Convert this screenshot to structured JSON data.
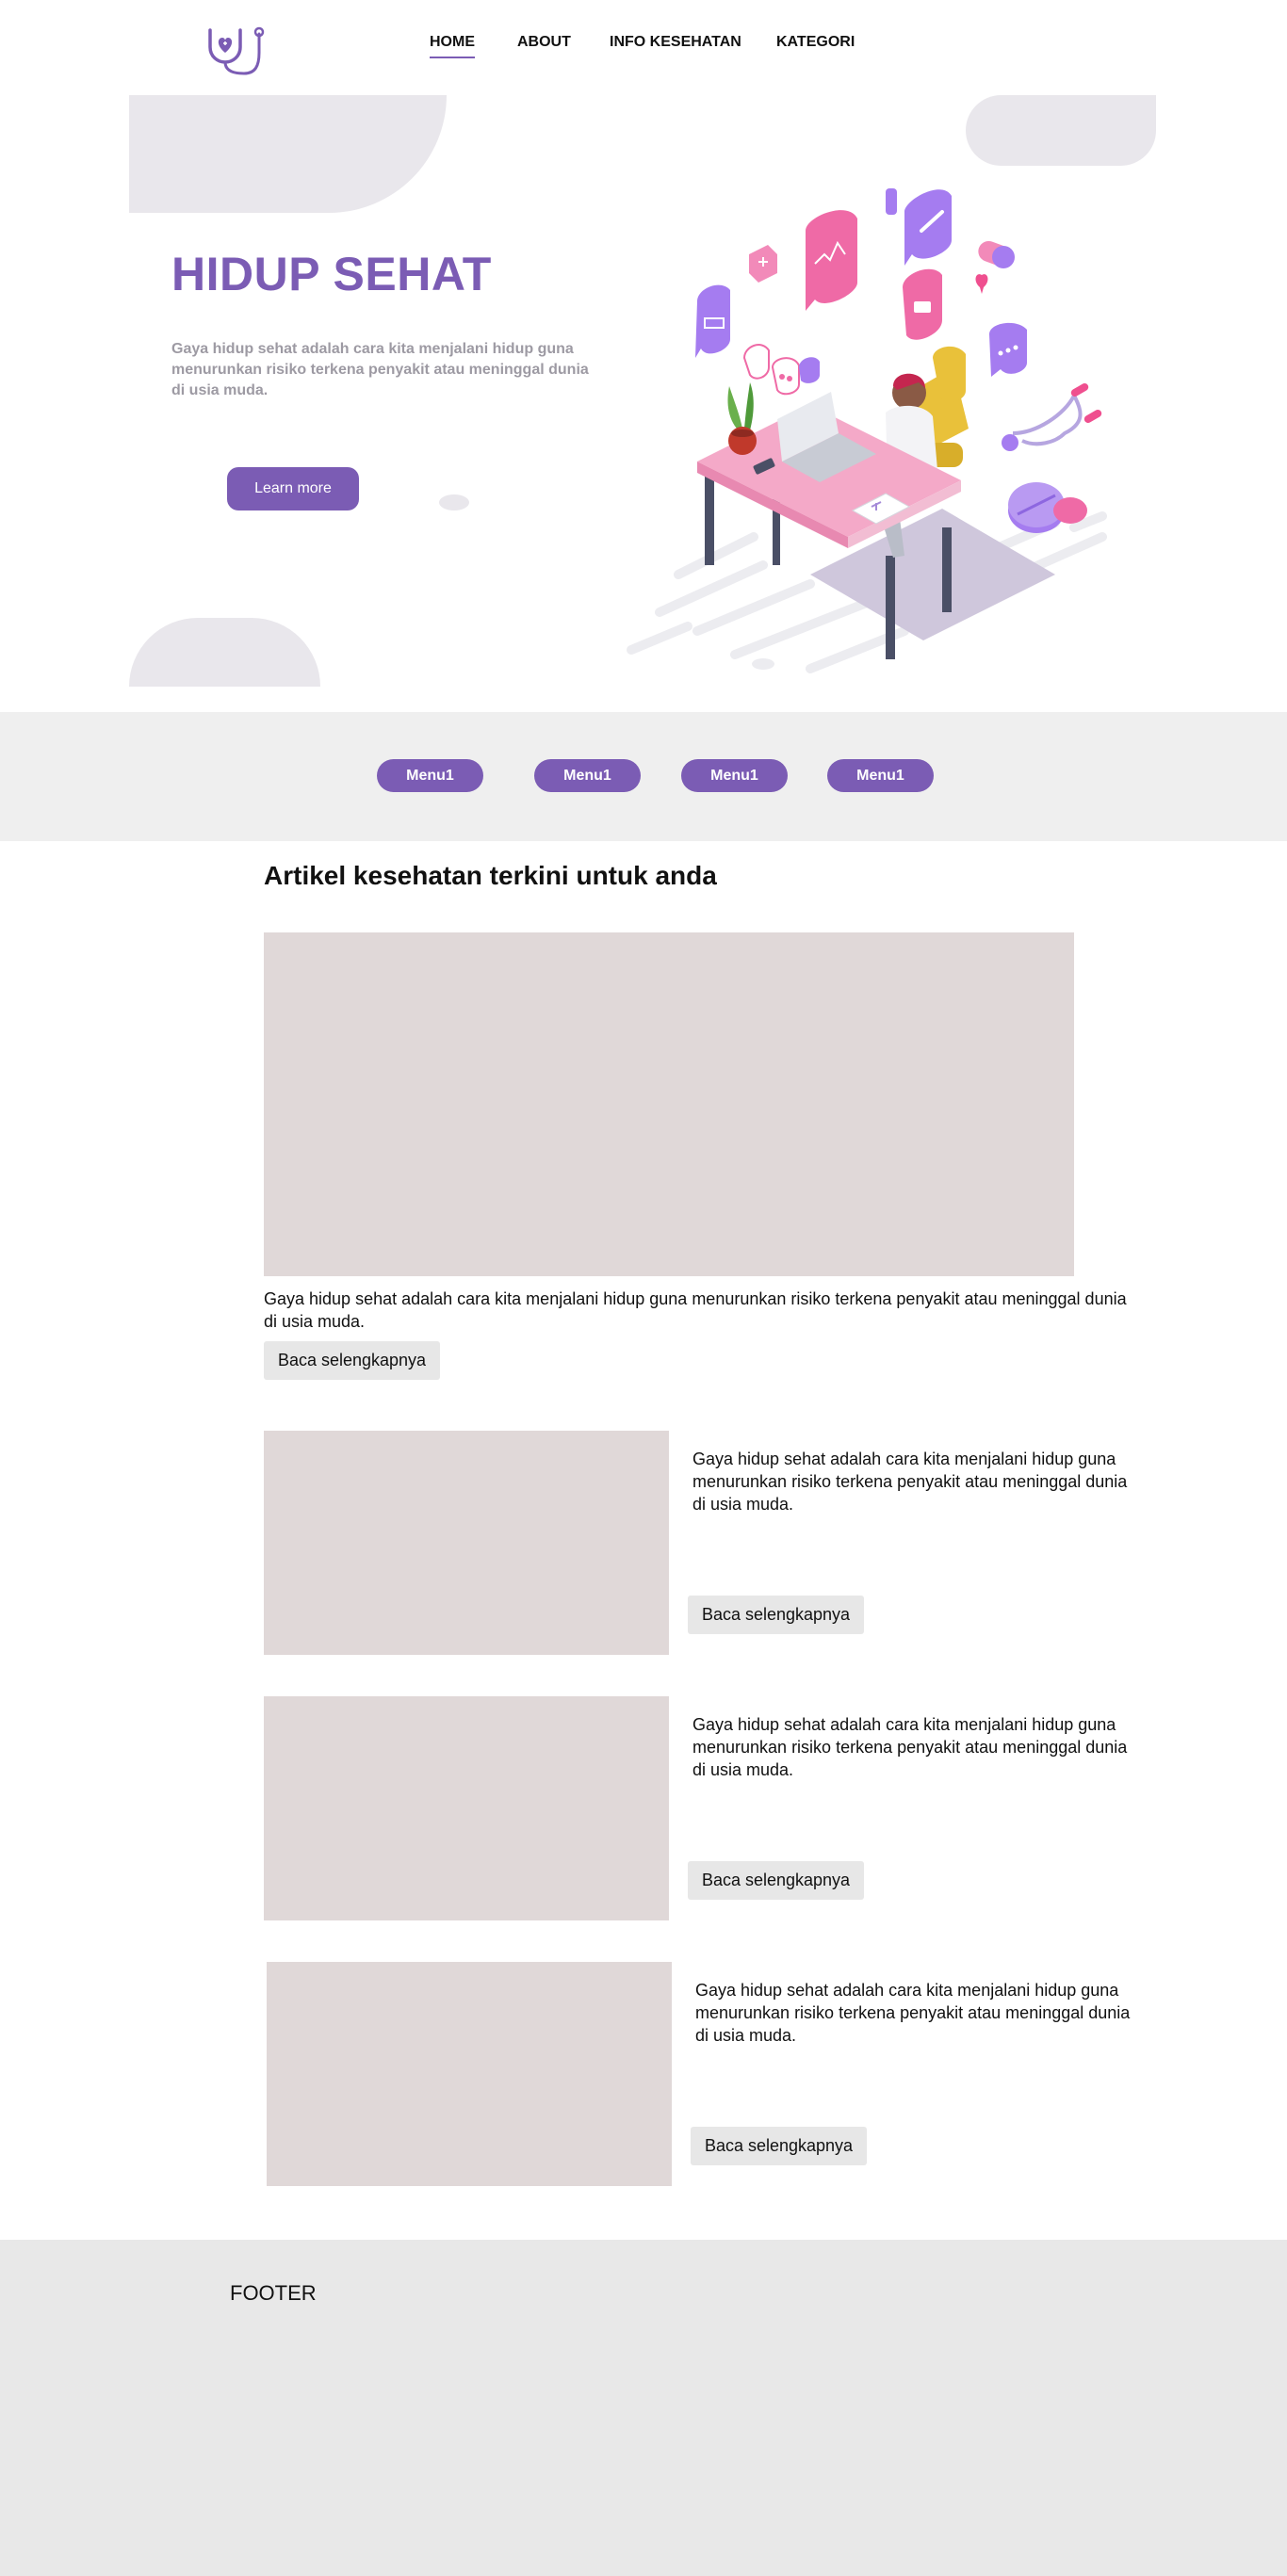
{
  "nav": {
    "items": [
      {
        "label": "HOME"
      },
      {
        "label": "ABOUT"
      },
      {
        "label": "INFO KESEHATAN"
      },
      {
        "label": "KATEGORI"
      }
    ],
    "active": "HOME"
  },
  "hero": {
    "title": "HIDUP SEHAT",
    "description": "Gaya hidup sehat adalah cara kita menjalani hidup guna menurunkan risiko terkena penyakit atau meninggal dunia di usia muda.",
    "button_label": "Learn more"
  },
  "menu": {
    "items": [
      {
        "label": "Menu1"
      },
      {
        "label": "Menu1"
      },
      {
        "label": "Menu1"
      },
      {
        "label": "Menu1"
      }
    ]
  },
  "articles": {
    "title": "Artikel kesehatan terkini untuk anda",
    "featured": {
      "text": "Gaya hidup sehat adalah cara kita menjalani hidup guna menurunkan risiko terkena penyakit atau meninggal dunia di usia muda.",
      "button_label": "Baca selengkapnya"
    },
    "list": [
      {
        "text": "Gaya hidup sehat adalah cara kita menjalani hidup guna menurunkan risiko terkena penyakit atau meninggal dunia di usia muda.",
        "button_label": "Baca selengkapnya"
      },
      {
        "text": "Gaya hidup sehat adalah cara kita menjalani hidup guna menurunkan risiko terkena penyakit atau meninggal dunia di usia muda.",
        "button_label": "Baca selengkapnya"
      },
      {
        "text": "Gaya hidup sehat adalah cara kita menjalani hidup guna menurunkan risiko terkena penyakit atau meninggal dunia di usia muda.",
        "button_label": "Baca selengkapnya"
      }
    ]
  },
  "footer": {
    "label": "FOOTER"
  },
  "colors": {
    "brand": "#7b5cb4",
    "pink": "#f28ab9",
    "placeholder": "#e0d8d8",
    "blob": "#e9e7ec"
  }
}
